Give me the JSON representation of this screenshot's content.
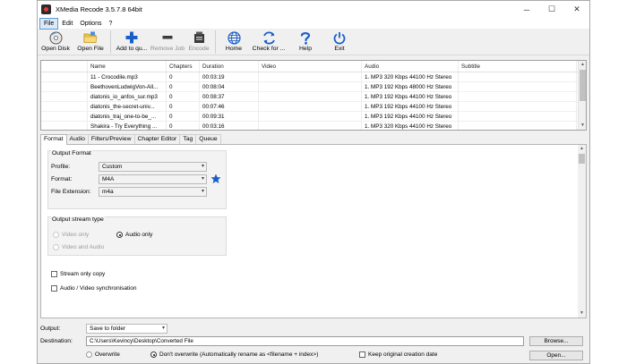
{
  "window": {
    "title": "XMedia Recode 3.5.7.8 64bit",
    "controls": [
      "─",
      "☐",
      "✕"
    ]
  },
  "menu": [
    "File",
    "Edit",
    "Options",
    "?"
  ],
  "toolbar": [
    {
      "label": "Open Disk",
      "icon": "disc-icon",
      "disabled": false
    },
    {
      "label": "Open File",
      "icon": "folder-icon",
      "disabled": false
    },
    {
      "label": "Add to qu...",
      "icon": "plus-icon",
      "disabled": false
    },
    {
      "label": "Remove Job",
      "icon": "minus-icon",
      "disabled": true
    },
    {
      "label": "Encode",
      "icon": "encode-icon",
      "disabled": true
    },
    {
      "label": "Home",
      "icon": "globe-icon",
      "disabled": false
    },
    {
      "label": "Check for ...",
      "icon": "refresh-icon",
      "disabled": false
    },
    {
      "label": "Help",
      "icon": "help-icon",
      "disabled": false
    },
    {
      "label": "Exit",
      "icon": "power-icon",
      "disabled": false
    }
  ],
  "file_list": {
    "columns": [
      "",
      "Name",
      "Chapters",
      "Duration",
      "Video",
      "Audio",
      "Subtitle"
    ],
    "rows": [
      [
        "",
        "11 - Crocodile.mp3",
        "0",
        "00:03:19",
        "",
        "1. MP3 320 Kbps 44100 Hz Stereo",
        ""
      ],
      [
        "",
        "BeethovenLudwigVon-All...",
        "0",
        "00:08:04",
        "",
        "1. MP3 192 Kbps 48000 Hz Stereo",
        ""
      ],
      [
        "",
        "diatonis_io_anfos_sur.mp3",
        "0",
        "00:08:37",
        "",
        "1. MP3 192 Kbps 44100 Hz Stereo",
        ""
      ],
      [
        "",
        "diatonis_the-secret-univ...",
        "0",
        "00:07:46",
        "",
        "1. MP3 192 Kbps 44100 Hz Stereo",
        ""
      ],
      [
        "",
        "diatonis_traj_one-to-be_...",
        "0",
        "00:09:31",
        "",
        "1. MP3 192 Kbps 44100 Hz Stereo",
        ""
      ],
      [
        "",
        "Shakira - Try Everything ...",
        "0",
        "00:03:16",
        "",
        "1. MP3 320 Kbps 44100 Hz Stereo",
        ""
      ]
    ]
  },
  "tabs": [
    {
      "label": "Format",
      "active": true
    },
    {
      "label": "Audio",
      "active": false
    },
    {
      "label": "Filters/Preview",
      "active": false
    },
    {
      "label": "Chapter Editor",
      "active": false
    },
    {
      "label": "Tag",
      "active": false
    },
    {
      "label": "Queue",
      "active": false
    }
  ],
  "output_format": {
    "title": "Output Format",
    "profile_label": "Profile:",
    "profile_value": "Custom",
    "format_label": "Format:",
    "format_value": "M4A",
    "ext_label": "File Extension:",
    "ext_value": "m4a"
  },
  "stream_type": {
    "title": "Output stream type",
    "video_only": "Video only",
    "audio_only": "Audio only",
    "video_audio": "Video and Audio"
  },
  "options": {
    "stream_copy": "Stream only copy",
    "av_sync": "Audio / Video synchronisation"
  },
  "bottom": {
    "output_label": "Output:",
    "output_value": "Save to folder",
    "dest_label": "Destination:",
    "dest_value": "C:\\Users\\Kevincy\\Desktop\\Converted File",
    "browse": "Browse...",
    "open": "Open...",
    "overwrite": "Overwrite",
    "dont_overwrite": "Don't overwrite (Automatically rename as <filename + index>)",
    "keep_date": "Keep original creation date"
  },
  "colors": {
    "accent_blue": "#1a5fc8",
    "icon_dark": "#2b2b2b"
  }
}
